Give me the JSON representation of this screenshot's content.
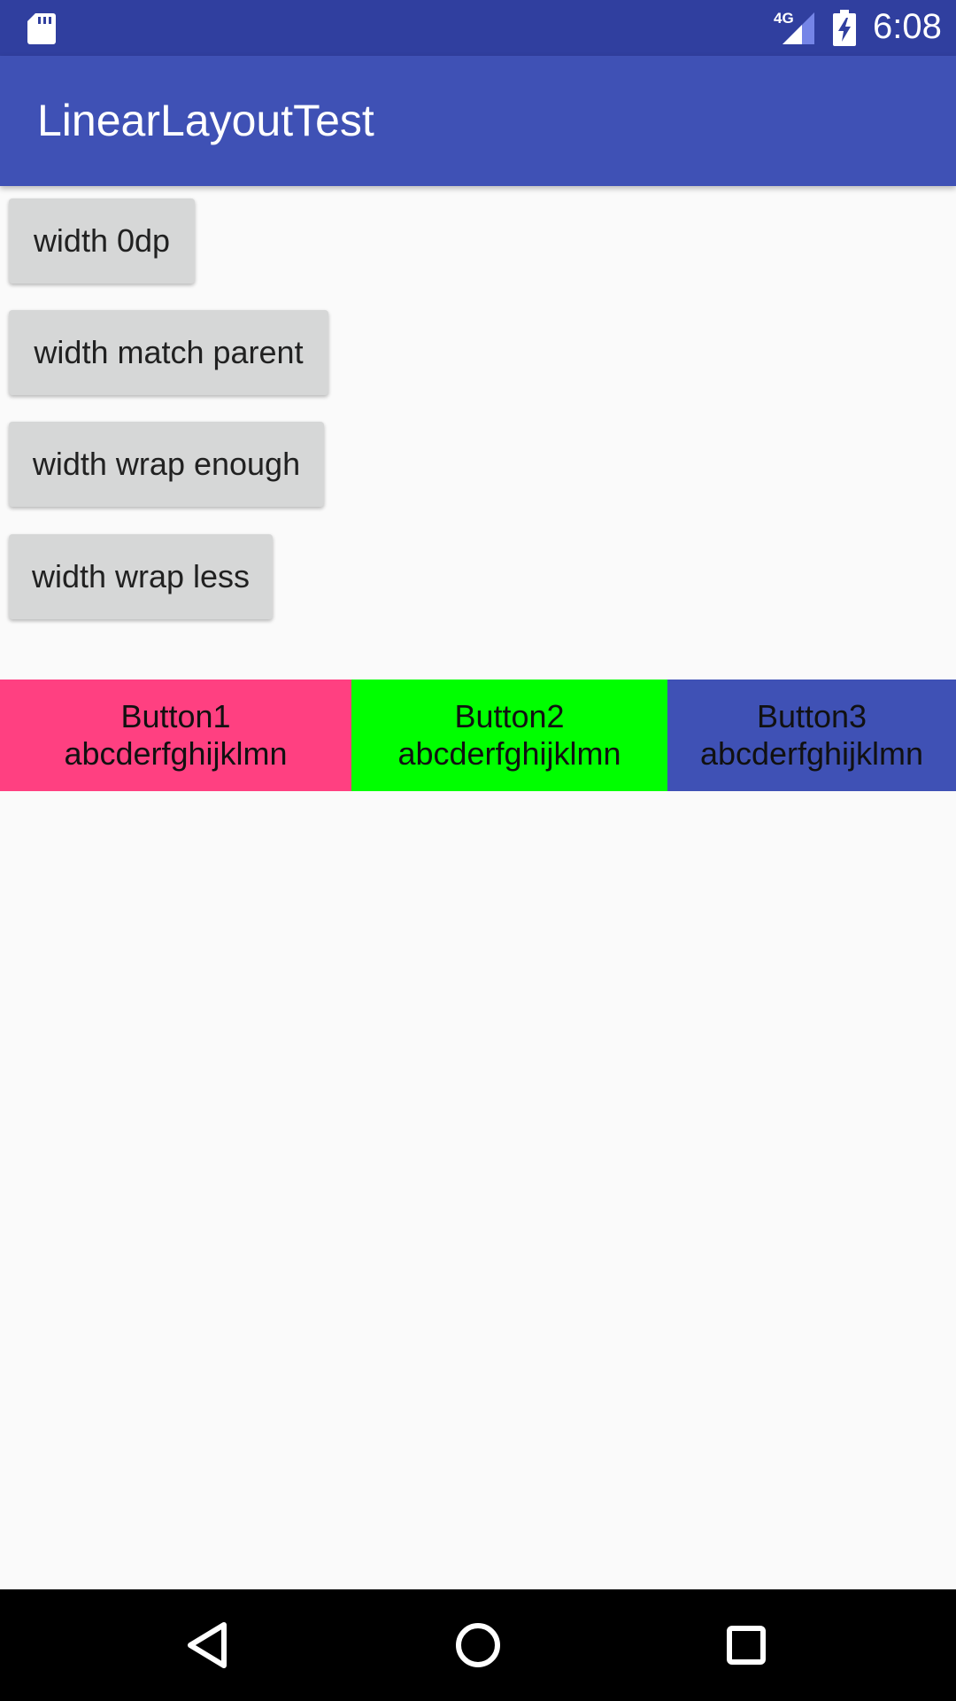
{
  "status_bar": {
    "time": "6:08",
    "network": "4G",
    "icons": [
      "sd-card-icon",
      "signal-icon",
      "battery-charging-icon"
    ],
    "background": "#303f9f"
  },
  "app_bar": {
    "title": "LinearLayoutTest",
    "background": "#3f51b5"
  },
  "buttons": [
    {
      "label": "width 0dp"
    },
    {
      "label": "width match parent"
    },
    {
      "label": "width wrap enough"
    },
    {
      "label": "width wrap less"
    }
  ],
  "color_buttons": [
    {
      "line1": "Button1",
      "line2": "abcderfghijklmn",
      "color": "#ff4081"
    },
    {
      "line1": "Button2",
      "line2": "abcderfghijklmn",
      "color": "#00ff00"
    },
    {
      "line1": "Button3",
      "line2": "abcderfghijklmn",
      "color": "#3f51b5"
    }
  ],
  "nav_bar": {
    "icons": [
      "back-icon",
      "home-icon",
      "recents-icon"
    ]
  }
}
